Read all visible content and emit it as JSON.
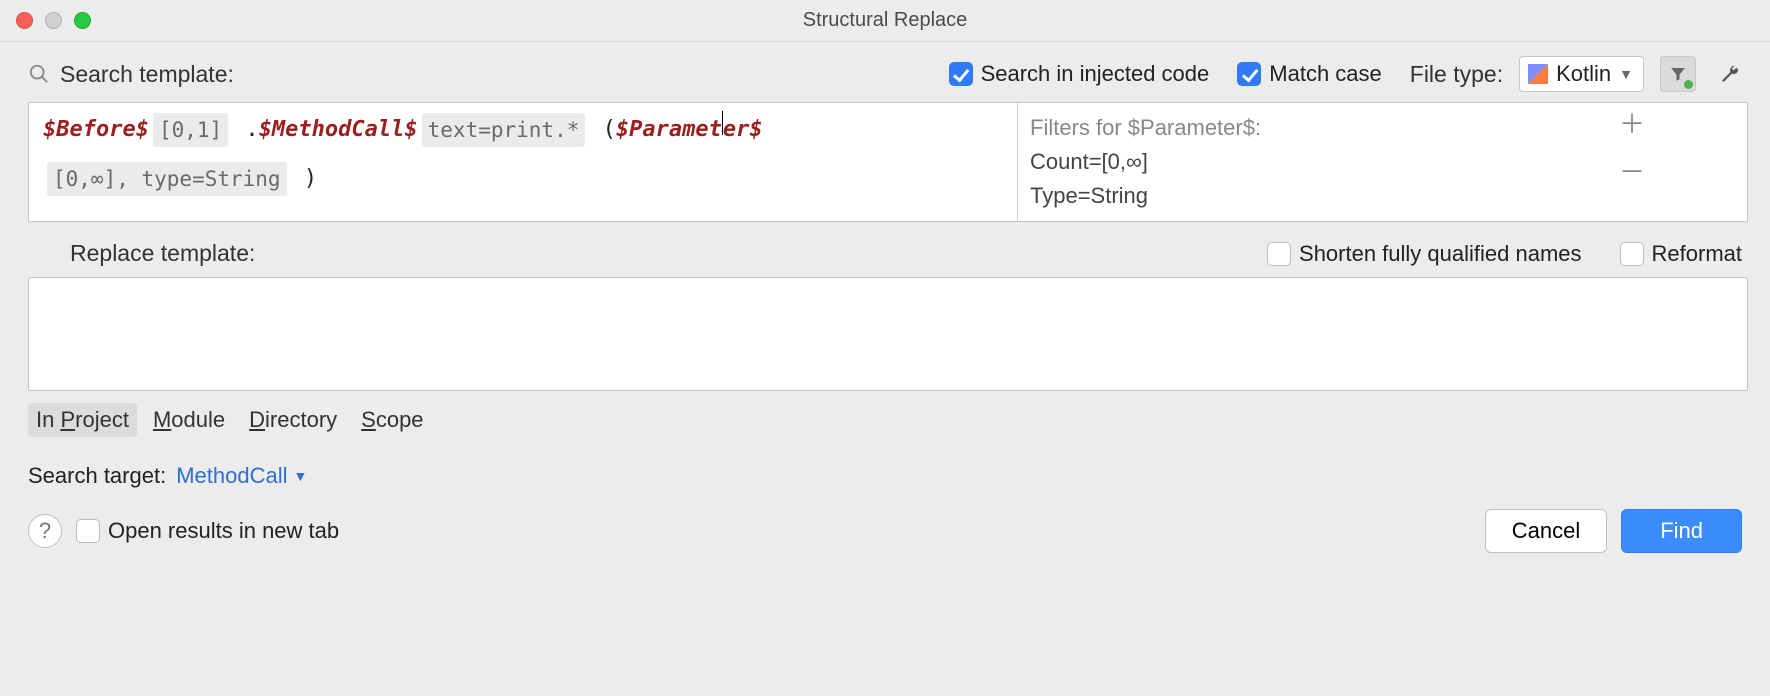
{
  "window": {
    "title": "Structural Replace"
  },
  "toolbar": {
    "search_label": "Search template:",
    "checks": {
      "injected": {
        "label": "Search in injected code",
        "checked": true
      },
      "matchcase": {
        "label": "Match case",
        "checked": true
      }
    },
    "filetype_label": "File type:",
    "filetype_value": "Kotlin"
  },
  "template": {
    "before_var": "$Before$",
    "before_badge": "[0,1]",
    "dot": " .",
    "method_var": "$MethodCall$",
    "method_badge": "text=print.*",
    "open_paren": " (",
    "param_var_a": "$Paramet",
    "param_var_b": "er$",
    "param_badge": "[0,∞], type=String",
    "close_paren": " )"
  },
  "filters": {
    "title": "Filters for $Parameter$:",
    "line1": "Count=[0,∞]",
    "line2": "Type=String"
  },
  "replace": {
    "label": "Replace template:",
    "shorten": {
      "label": "Shorten fully qualified names",
      "checked": false
    },
    "reformat": {
      "label": "Reformat",
      "checked": false
    }
  },
  "scopes": {
    "project": "In Project",
    "module": "Module",
    "directory": "Directory",
    "scope": "Scope"
  },
  "target": {
    "label": "Search target:",
    "value": "MethodCall"
  },
  "bottom": {
    "open_new_tab": "Open results in new tab",
    "cancel": "Cancel",
    "find": "Find"
  }
}
